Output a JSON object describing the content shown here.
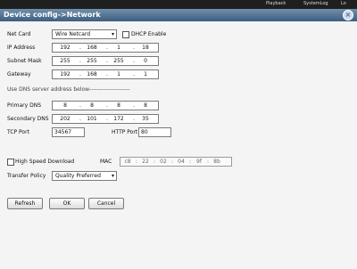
{
  "topbar": {
    "items": [
      "Playback",
      "SystemLog",
      "Lo"
    ]
  },
  "window": {
    "title": "Device config->Network",
    "close_label": "×"
  },
  "net_card": {
    "label": "Net Card",
    "value": "Wire Netcard"
  },
  "dhcp": {
    "label": "DHCP Enable",
    "checked": false
  },
  "ip_address": {
    "label": "IP Address",
    "octets": [
      "192",
      "168",
      "1",
      "18"
    ]
  },
  "subnet_mask": {
    "label": "Subnet Mask",
    "octets": [
      "255",
      "255",
      "255",
      "0"
    ]
  },
  "gateway": {
    "label": "Gateway",
    "octets": [
      "192",
      "168",
      "1",
      "1"
    ]
  },
  "dns_note": "Use DNS server address below---------------------",
  "primary_dns": {
    "label": "Primary DNS",
    "octets": [
      "8",
      "8",
      "8",
      "8"
    ]
  },
  "secondary_dns": {
    "label": "Secondary DNS",
    "octets": [
      "202",
      "101",
      "172",
      "35"
    ]
  },
  "tcp_port": {
    "label": "TCP Port",
    "value": "34567"
  },
  "http_port": {
    "label": "HTTP Port",
    "value": "80"
  },
  "high_speed": {
    "label": "High Speed Download",
    "checked": false
  },
  "mac": {
    "label": "MAC",
    "parts": [
      "c8",
      "22",
      "02",
      "04",
      "9f",
      "8b"
    ]
  },
  "transfer_policy": {
    "label": "Transfer Policy",
    "value": "Quality Preferred"
  },
  "buttons": {
    "refresh": "Refresh",
    "ok": "OK",
    "cancel": "Cancel"
  }
}
